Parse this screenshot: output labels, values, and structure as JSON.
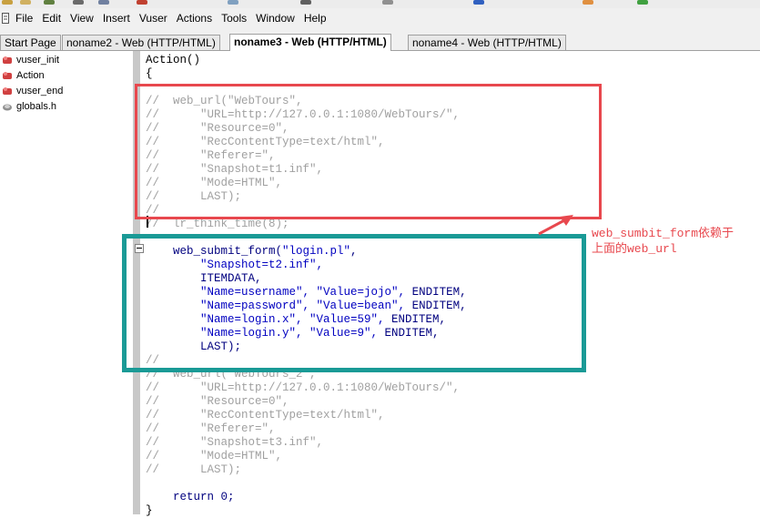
{
  "menubar": {
    "items": [
      {
        "label": "File"
      },
      {
        "label": "Edit"
      },
      {
        "label": "View"
      },
      {
        "label": "Insert"
      },
      {
        "label": "Vuser"
      },
      {
        "label": "Actions"
      },
      {
        "label": "Tools"
      },
      {
        "label": "Window"
      },
      {
        "label": "Help"
      }
    ]
  },
  "tabs": [
    {
      "label": "Start Page"
    },
    {
      "label": "noname2 - Web (HTTP/HTML)"
    },
    {
      "label": "noname3 - Web (HTTP/HTML)"
    },
    {
      "label": "noname4 - Web (HTTP/HTML)"
    }
  ],
  "tree": {
    "items": [
      {
        "label": "vuser_init"
      },
      {
        "label": "Action"
      },
      {
        "label": "vuser_end"
      },
      {
        "label": "globals.h"
      }
    ]
  },
  "code": {
    "l01": "Action()",
    "l02": "{",
    "l03": "//  web_url(\"WebTours\",",
    "l04": "//      \"URL=http://127.0.0.1:1080/WebTours/\",",
    "l05": "//      \"Resource=0\",",
    "l06": "//      \"RecContentType=text/html\",",
    "l07": "//      \"Referer=\",",
    "l08": "//      \"Snapshot=t1.inf\",",
    "l09": "//      \"Mode=HTML\",",
    "l10": "//      LAST);",
    "l11": "//",
    "l12": "//  lr_think_time(8);",
    "l14a": "    web_submit_form(",
    "l14b": "\"login.pl\"",
    "l14c": ",",
    "l15": "        \"Snapshot=t2.inf\",",
    "l16": "        ITEMDATA,",
    "l17a": "        \"Name=username\", \"Value=jojo\", ",
    "l17b": "ENDITEM,",
    "l18a": "        \"Name=password\", \"Value=bean\", ",
    "l18b": "ENDITEM,",
    "l19a": "        \"Name=login.x\", \"Value=59\", ",
    "l19b": "ENDITEM,",
    "l20a": "        \"Name=login.y\", \"Value=9\", ",
    "l20b": "ENDITEM,",
    "l21": "        LAST);",
    "l22": "//",
    "l23": "//  web_url(\"WebTours_2\",",
    "l24": "//      \"URL=http://127.0.0.1:1080/WebTours/\",",
    "l25": "//      \"Resource=0\",",
    "l26": "//      \"RecContentType=text/html\",",
    "l27": "//      \"Referer=\",",
    "l28": "//      \"Snapshot=t3.inf\",",
    "l29": "//      \"Mode=HTML\",",
    "l30": "//      LAST);",
    "l32": "    return 0;",
    "l33": "}"
  },
  "annotation": {
    "line1": "web_sumbit_form依赖于",
    "line2": "上面的web_url"
  },
  "colors": {
    "red_box": "#e8484e",
    "teal_box": "#1a9a96",
    "comment": "#a0a0a0",
    "string": "#0000c0"
  }
}
